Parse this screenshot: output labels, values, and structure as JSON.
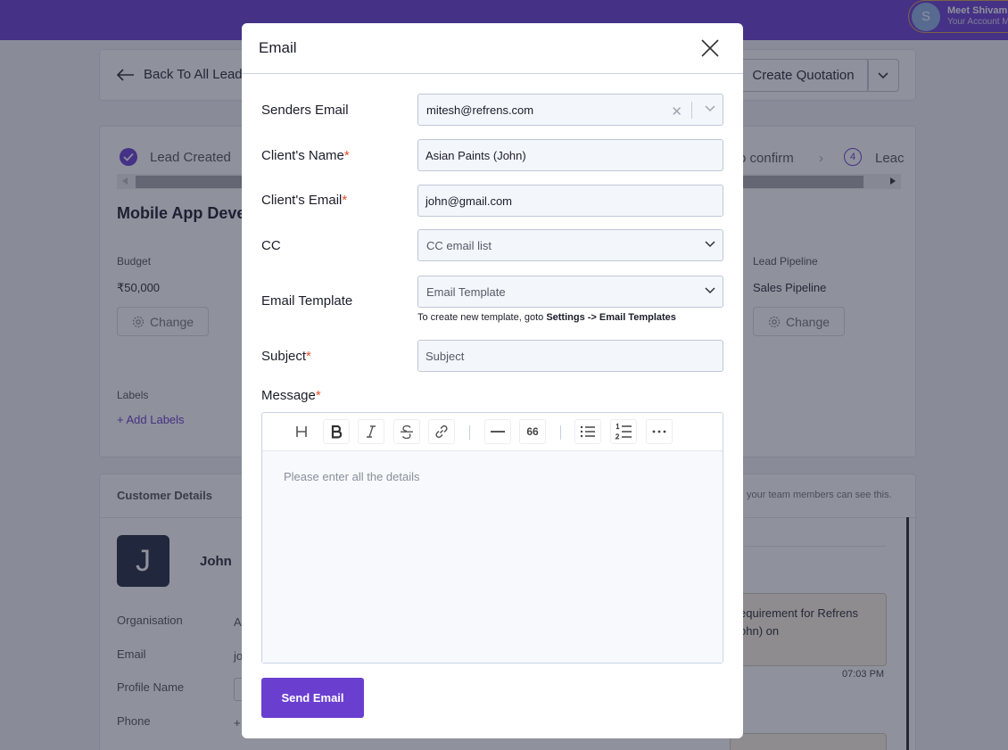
{
  "account": {
    "avatar_letter": "S",
    "name": "Meet Shivam",
    "subtitle": "Your Account M"
  },
  "header": {
    "back_label": "Back To All Lead",
    "create_quotation": "Create Quotation"
  },
  "lead": {
    "step_created": "Lead Created",
    "step_confirm": "o confirm",
    "step_num": "4",
    "step_lead": "Leac",
    "title": "Mobile App Deve",
    "budget_label": "Budget",
    "budget_value": "₹50,000",
    "pipeline_label": "Lead Pipeline",
    "pipeline_value": "Sales Pipeline",
    "change_label": "Change",
    "labels_label": "Labels",
    "add_labels": "+ Add Labels"
  },
  "customer": {
    "heading": "Customer Details",
    "note": "your team members can see this.",
    "avatar_letter": "J",
    "name": "John",
    "fields": [
      "Organisation",
      "Email",
      "Profile Name",
      "Phone"
    ],
    "org_value": "A",
    "email_value": "jo",
    "phone_value": "+",
    "note_line1": "equirement for Refrens",
    "note_line2": "ohn) on",
    "note_time": "07:03 PM"
  },
  "modal": {
    "title": "Email",
    "senders_email_label": "Senders Email",
    "senders_email_value": "mitesh@refrens.com",
    "client_name_label": "Client's Name",
    "client_name_value": "Asian Paints (John)",
    "client_email_label": "Client's Email",
    "client_email_value": "john@gmail.com",
    "cc_label": "CC",
    "cc_placeholder": "CC email list",
    "template_label": "Email Template",
    "template_placeholder": "Email Template",
    "hint_prefix": "To create new template, goto ",
    "hint_bold": "Settings -> Email Templates",
    "subject_label": "Subject",
    "subject_placeholder": "Subject",
    "message_label": "Message",
    "message_placeholder": "Please enter all the details",
    "required_mark": "*",
    "send_label": "Send Email",
    "toolbar": {
      "quote_glyph": "66"
    }
  }
}
